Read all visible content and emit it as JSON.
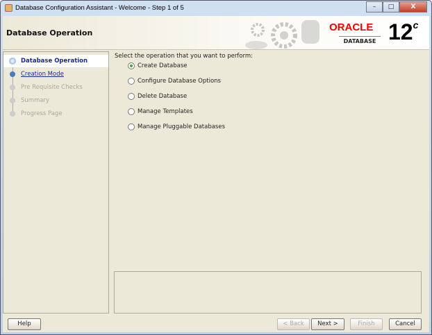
{
  "window": {
    "title": "Database Configuration Assistant - Welcome - Step 1 of 5",
    "minimize": "–",
    "maximize": "□",
    "close": "X"
  },
  "header": {
    "title": "Database Operation",
    "brand": "ORACLE",
    "product": "DATABASE",
    "version": "12",
    "version_sup": "c"
  },
  "steps": [
    {
      "label": "Database Operation",
      "state": "active"
    },
    {
      "label": "Creation Mode",
      "state": "link"
    },
    {
      "label": "Pre Requisite Checks",
      "state": "disabled"
    },
    {
      "label": "Summary",
      "state": "disabled"
    },
    {
      "label": "Progress Page",
      "state": "disabled"
    }
  ],
  "main": {
    "prompt": "Select the operation that you want to perform:",
    "options": [
      {
        "label": "Create Database",
        "selected": true
      },
      {
        "label": "Configure Database Options",
        "selected": false
      },
      {
        "label": "Delete Database",
        "selected": false
      },
      {
        "label": "Manage Templates",
        "selected": false
      },
      {
        "label": "Manage Pluggable Databases",
        "selected": false
      }
    ]
  },
  "buttons": {
    "help": "Help",
    "back": "< Back",
    "next": "Next >",
    "finish": "Finish",
    "cancel": "Cancel"
  }
}
